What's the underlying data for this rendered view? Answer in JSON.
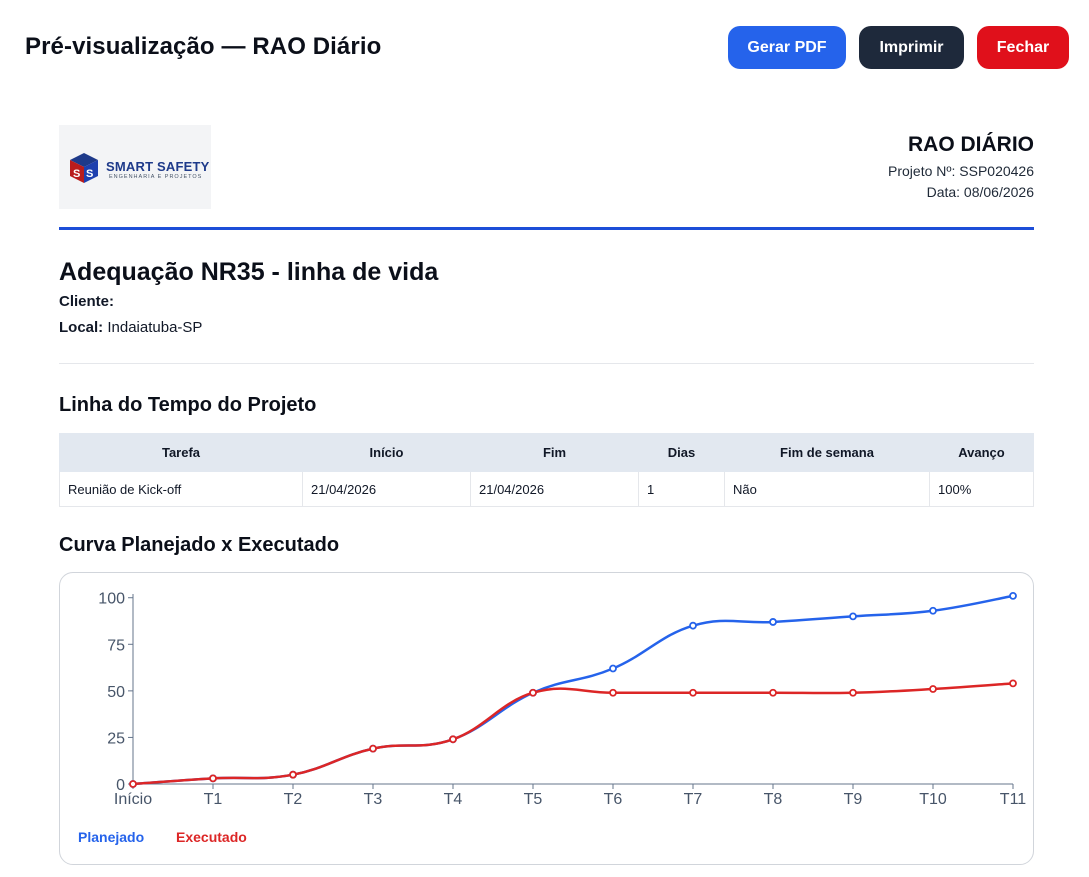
{
  "header": {
    "title": "Pré-visualização — RAO Diário",
    "buttons": {
      "pdf": "Gerar PDF",
      "print": "Imprimir",
      "close": "Fechar"
    }
  },
  "logo": {
    "name": "SMART SAFETY",
    "tagline": "ENGENHARIA E PROJETOS"
  },
  "document": {
    "title": "RAO DIÁRIO",
    "project_number": "Projeto Nº: SSP020426",
    "date": "Data: 08/06/2026"
  },
  "project": {
    "name": "Adequação NR35 - linha de vida",
    "client_label": "Cliente:",
    "client_value": "",
    "location_label": "Local:",
    "location_value": "Indaiatuba-SP"
  },
  "timeline": {
    "title": "Linha do Tempo do Projeto",
    "columns": [
      "Tarefa",
      "Início",
      "Fim",
      "Dias",
      "Fim de semana",
      "Avanço"
    ],
    "rows": [
      [
        "Reunião de Kick-off",
        "21/04/2026",
        "21/04/2026",
        "1",
        "Não",
        "100%"
      ]
    ]
  },
  "curve_title": "Curva Planejado x Executado",
  "colors": {
    "accent": "#2563eb",
    "planned": "#2563eb",
    "executed": "#dc2626",
    "dark": "#1e293b",
    "danger": "#e0101b"
  },
  "chart_data": {
    "type": "line",
    "categories": [
      "Início",
      "T1",
      "T2",
      "T3",
      "T4",
      "T5",
      "T6",
      "T7",
      "T8",
      "T9",
      "T10",
      "T11"
    ],
    "series": [
      {
        "name": "Planejado",
        "values": [
          0,
          3,
          5,
          19,
          24,
          49,
          62,
          85,
          87,
          90,
          93,
          101
        ]
      },
      {
        "name": "Executado",
        "values": [
          0,
          3,
          5,
          19,
          24,
          49,
          49,
          49,
          49,
          49,
          51,
          54
        ]
      }
    ],
    "yticks": [
      0,
      25,
      50,
      75,
      100
    ],
    "ylim": [
      0,
      102
    ],
    "grid": false,
    "legend": "bottom-left"
  }
}
